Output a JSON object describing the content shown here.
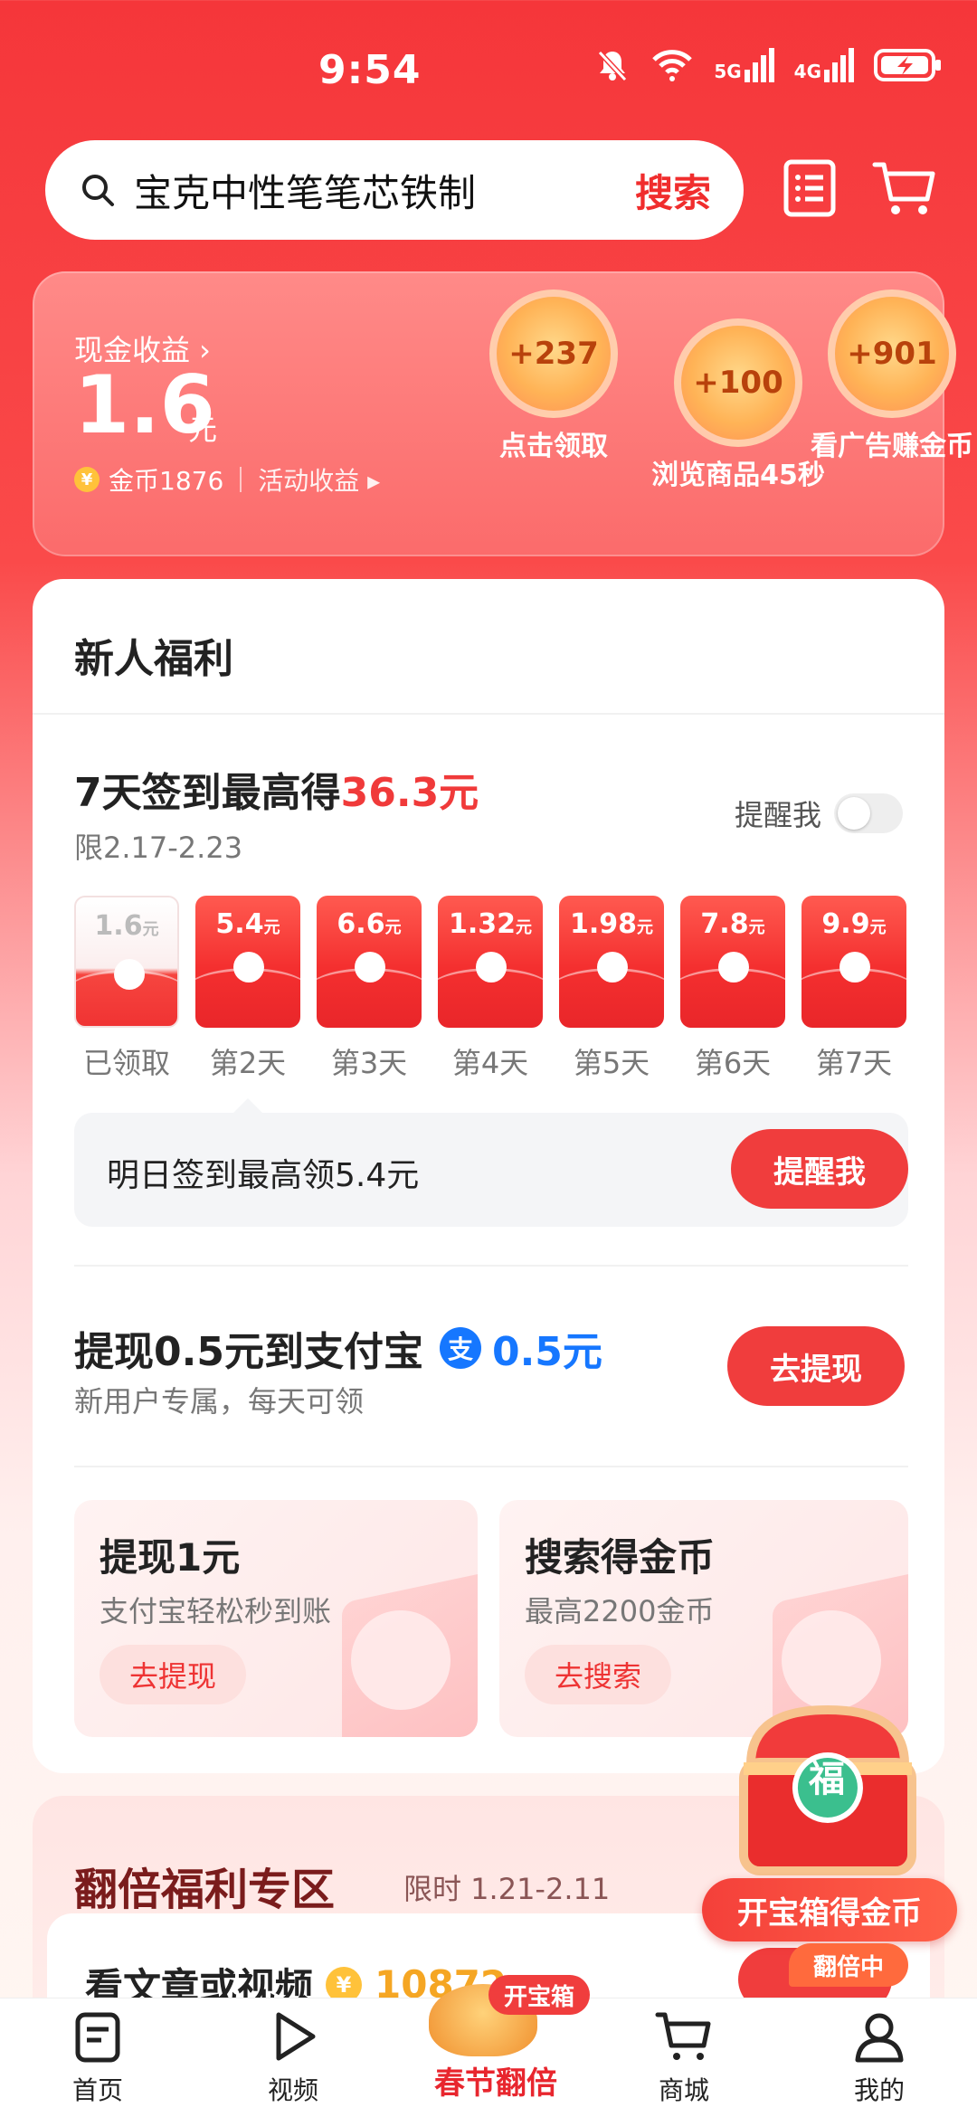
{
  "status_bar": {
    "time": "9:54",
    "signal1": "5G",
    "signal2": "4G"
  },
  "search": {
    "query": "宝克中性笔笔芯铁制",
    "button": "搜索"
  },
  "earnings": {
    "label": "现金收益 ›",
    "amount": "1.6",
    "unit": "元",
    "coins": "金币1876",
    "activity": "活动收益 ▸",
    "bubbles": [
      {
        "value": "+237",
        "caption": "点击领取"
      },
      {
        "value": "+100",
        "caption": "浏览商品45秒"
      },
      {
        "value": "+901",
        "caption": "看广告赚金币"
      }
    ]
  },
  "panel": {
    "title": "新人福利",
    "sign": {
      "title_prefix": "7天签到最高得",
      "title_amount": "36.3元",
      "range": "限2.17-2.23",
      "remind_label": "提醒我",
      "days": [
        {
          "value": "1.6",
          "unit": "元",
          "label": "已领取",
          "claimed": true
        },
        {
          "value": "5.4",
          "unit": "元",
          "label": "第2天"
        },
        {
          "value": "6.6",
          "unit": "元",
          "label": "第3天"
        },
        {
          "value": "1.32",
          "unit": "元",
          "label": "第4天"
        },
        {
          "value": "1.98",
          "unit": "元",
          "label": "第5天"
        },
        {
          "value": "7.8",
          "unit": "元",
          "label": "第6天"
        },
        {
          "value": "9.9",
          "unit": "元",
          "label": "第7天"
        }
      ],
      "tip": "明日签到最高领5.4元",
      "tip_button": "提醒我"
    },
    "withdraw": {
      "title": "提现0.5元到支付宝",
      "alipay_glyph": "支",
      "amount": "0.5元",
      "sub": "新用户专属，每天可领",
      "button": "去提现"
    },
    "minis": [
      {
        "title": "提现1元",
        "sub": "支付宝轻松秒到账",
        "button": "去提现"
      },
      {
        "title": "搜索得金币",
        "sub": "最高2200金币",
        "button": "去搜索"
      }
    ]
  },
  "double": {
    "title": "翻倍福利专区",
    "limit": "限时 1.21-2.11",
    "task": "看文章或视频",
    "coins": "10872",
    "badge": "翻倍中"
  },
  "chest": {
    "glyph": "福",
    "label": "开宝箱得金币"
  },
  "nav": {
    "items": [
      "首页",
      "视频",
      "商城",
      "我的"
    ],
    "center_pill": "开宝箱",
    "center_text": "春节翻倍"
  },
  "colors": {
    "accent": "#f03d3d",
    "blue": "#1677ff",
    "gold": "#f5a623"
  }
}
